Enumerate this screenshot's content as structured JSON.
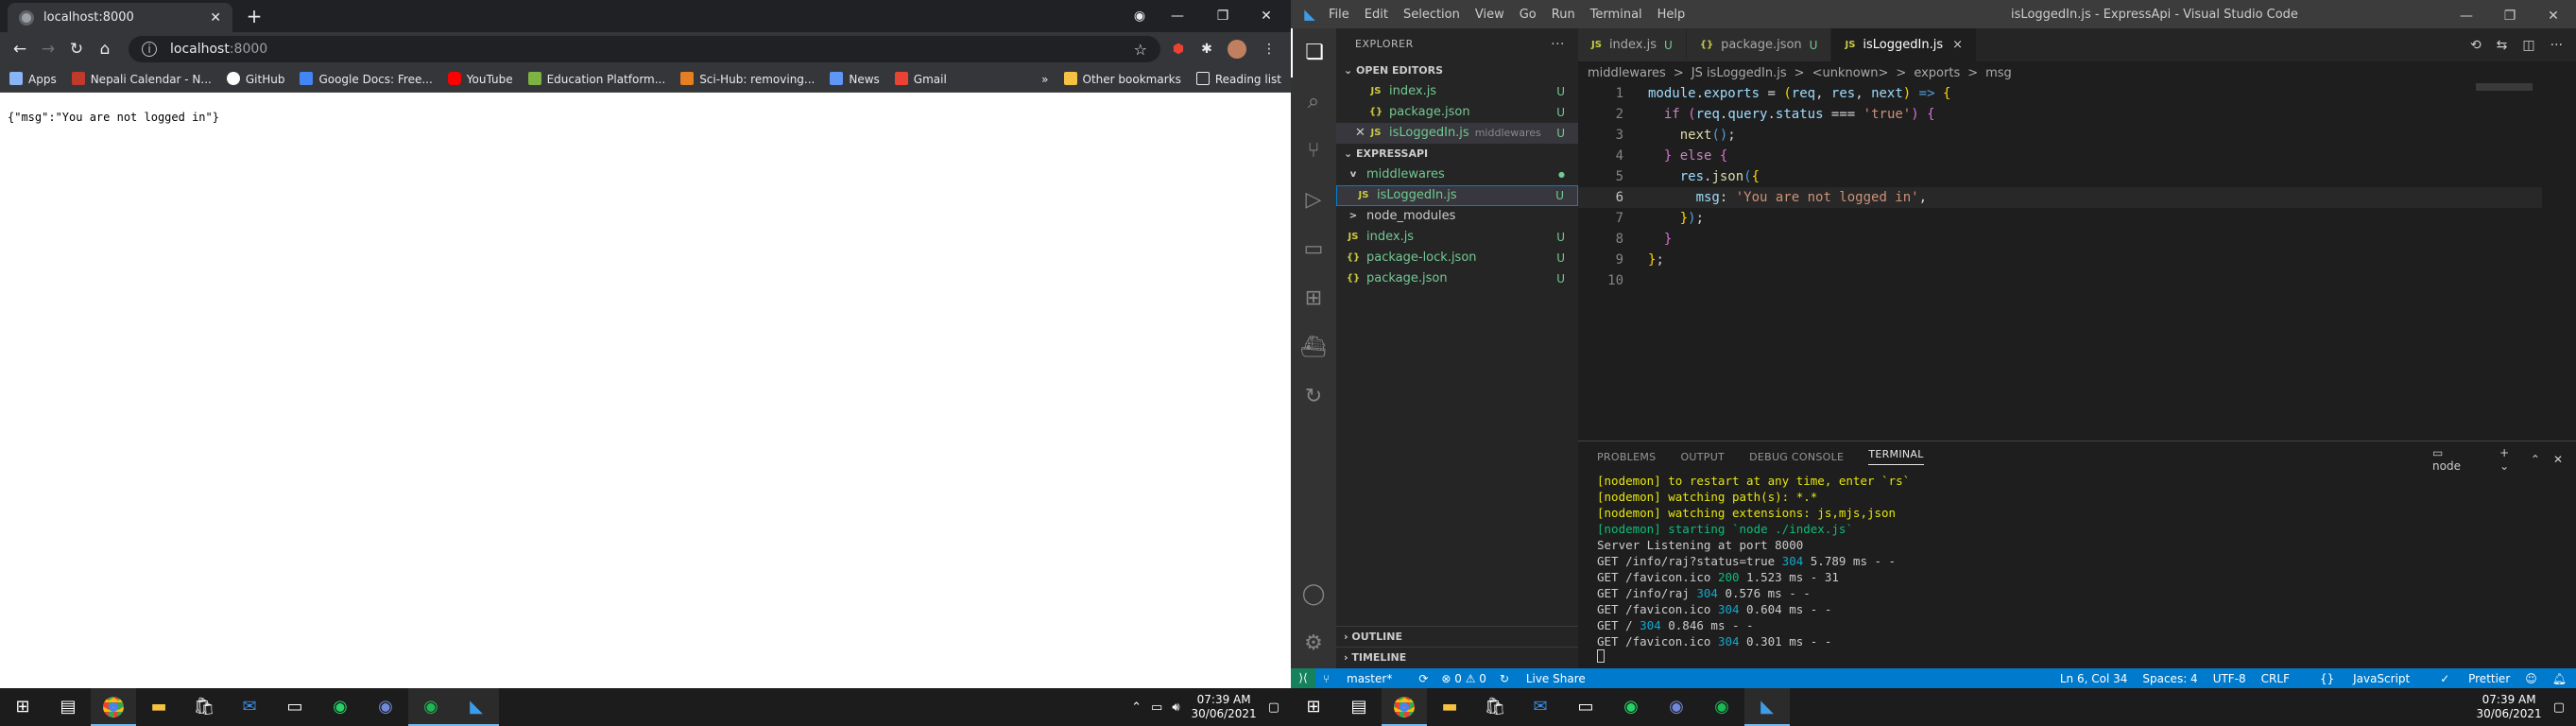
{
  "chrome": {
    "tab_title": "localhost:8000",
    "address_host": "localhost",
    "address_port": ":8000",
    "bookmarks": [
      "Apps",
      "Nepali Calendar - N...",
      "GitHub",
      "Google Docs: Free...",
      "YouTube",
      "Education Platform...",
      "Sci-Hub: removing...",
      "News",
      "Gmail"
    ],
    "other_bookmarks": "Other bookmarks",
    "reading_list": "Reading list",
    "page_text": "{\"msg\":\"You are not logged in\"}"
  },
  "vscode": {
    "menu": [
      "File",
      "Edit",
      "Selection",
      "View",
      "Go",
      "Run",
      "Terminal",
      "Help"
    ],
    "window_title": "isLoggedIn.js - ExpressApi - Visual Studio Code",
    "explorer_header": "EXPLORER",
    "open_editors": "OPEN EDITORS",
    "open_files": [
      {
        "icon": "JS",
        "name": "index.js",
        "sub": "",
        "status": "U"
      },
      {
        "icon": "{}",
        "name": "package.json",
        "sub": "",
        "status": "U"
      },
      {
        "icon": "JS",
        "name": "isLoggedIn.js",
        "sub": "middlewares",
        "status": "U"
      }
    ],
    "project": "EXPRESSAPI",
    "tree": [
      {
        "icon": "v",
        "name": "middlewares",
        "status": "●"
      },
      {
        "icon": "JS",
        "name": "isLoggedIn.js",
        "status": "U"
      },
      {
        "icon": ">",
        "name": "node_modules",
        "status": ""
      },
      {
        "icon": "JS",
        "name": "index.js",
        "status": "U"
      },
      {
        "icon": "{}",
        "name": "package-lock.json",
        "status": "U"
      },
      {
        "icon": "{}",
        "name": "package.json",
        "status": "U"
      }
    ],
    "outline": "OUTLINE",
    "timeline": "TIMELINE",
    "tabs": [
      {
        "icon": "JS",
        "name": "index.js",
        "status": "U"
      },
      {
        "icon": "{}",
        "name": "package.json",
        "status": "U"
      },
      {
        "icon": "JS",
        "name": "isLoggedIn.js",
        "status": "×"
      }
    ],
    "breadcrumb": [
      "middlewares",
      ">",
      "JS isLoggedIn.js",
      ">",
      "<unknown>",
      ">",
      "exports",
      ">",
      "msg"
    ],
    "panel_tabs": [
      "PROBLEMS",
      "OUTPUT",
      "DEBUG CONSOLE",
      "TERMINAL"
    ],
    "terminal_name": "node",
    "status_left": [
      "master*",
      "⟳",
      "⊗ 0 ⚠ 0",
      "Live Share"
    ],
    "status_right": [
      "Ln 6, Col 34",
      "Spaces: 4",
      "UTF-8",
      "CRLF",
      "JavaScript",
      "Prettier"
    ]
  },
  "taskbar": {
    "left_time": "07:39 AM",
    "left_date": "30/06/2021",
    "right_time": "07:39 AM",
    "right_date": "30/06/2021"
  }
}
